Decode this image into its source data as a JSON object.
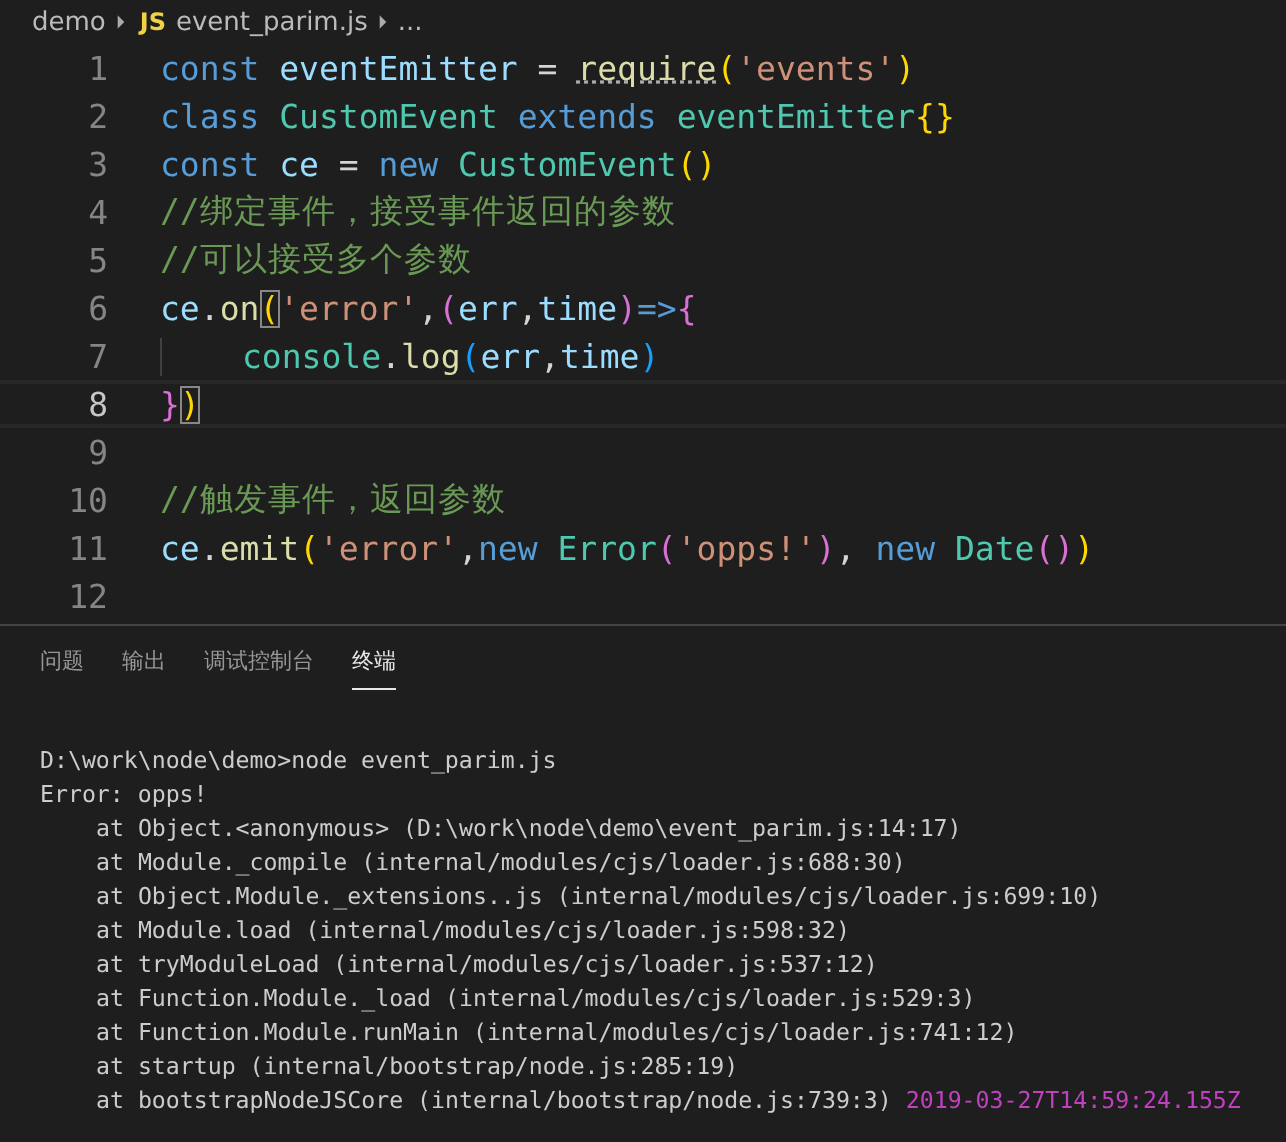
{
  "breadcrumb": {
    "folder": "demo",
    "file_badge": "JS",
    "file": "event_parim.js",
    "more": "..."
  },
  "editor": {
    "lines": [
      {
        "number": "1",
        "current": false,
        "indented": false,
        "tokens": [
          {
            "text": "const ",
            "kind": "keyword"
          },
          {
            "text": "eventEmitter",
            "kind": "var"
          },
          {
            "text": " = ",
            "kind": "plain"
          },
          {
            "text": "require",
            "kind": "func",
            "hinted": true
          },
          {
            "text": "(",
            "kind": "bracket1"
          },
          {
            "text": "'events'",
            "kind": "string"
          },
          {
            "text": ")",
            "kind": "bracket1"
          }
        ]
      },
      {
        "number": "2",
        "current": false,
        "indented": false,
        "tokens": [
          {
            "text": "class ",
            "kind": "keyword"
          },
          {
            "text": "CustomEvent ",
            "kind": "class"
          },
          {
            "text": "extends ",
            "kind": "keyword"
          },
          {
            "text": "eventEmitter",
            "kind": "class"
          },
          {
            "text": "{}",
            "kind": "bracket1"
          }
        ]
      },
      {
        "number": "3",
        "current": false,
        "indented": false,
        "tokens": [
          {
            "text": "const ",
            "kind": "keyword"
          },
          {
            "text": "ce",
            "kind": "var"
          },
          {
            "text": " = ",
            "kind": "plain"
          },
          {
            "text": "new ",
            "kind": "keyword"
          },
          {
            "text": "CustomEvent",
            "kind": "class"
          },
          {
            "text": "()",
            "kind": "bracket1"
          }
        ]
      },
      {
        "number": "4",
        "current": false,
        "indented": false,
        "tokens": [
          {
            "text": "//绑定事件，接受事件返回的参数",
            "kind": "comment"
          }
        ]
      },
      {
        "number": "5",
        "current": false,
        "indented": false,
        "tokens": [
          {
            "text": "//可以接受多个参数",
            "kind": "comment"
          }
        ]
      },
      {
        "number": "6",
        "current": false,
        "indented": false,
        "tokens": [
          {
            "text": "ce",
            "kind": "var"
          },
          {
            "text": ".",
            "kind": "plain"
          },
          {
            "text": "on",
            "kind": "func"
          },
          {
            "text": "(",
            "kind": "bracket1",
            "boxed": true
          },
          {
            "text": "'error'",
            "kind": "string"
          },
          {
            "text": ",",
            "kind": "plain"
          },
          {
            "text": "(",
            "kind": "bracket2"
          },
          {
            "text": "err",
            "kind": "var"
          },
          {
            "text": ",",
            "kind": "plain"
          },
          {
            "text": "time",
            "kind": "var"
          },
          {
            "text": ")",
            "kind": "bracket2"
          },
          {
            "text": "=>",
            "kind": "keyword"
          },
          {
            "text": "{",
            "kind": "bracket2"
          }
        ]
      },
      {
        "number": "7",
        "current": false,
        "indented": true,
        "tokens": [
          {
            "text": "console",
            "kind": "class"
          },
          {
            "text": ".",
            "kind": "plain"
          },
          {
            "text": "log",
            "kind": "func"
          },
          {
            "text": "(",
            "kind": "bracket3"
          },
          {
            "text": "err",
            "kind": "var"
          },
          {
            "text": ",",
            "kind": "plain"
          },
          {
            "text": "time",
            "kind": "var"
          },
          {
            "text": ")",
            "kind": "bracket3"
          }
        ]
      },
      {
        "number": "8",
        "current": true,
        "indented": false,
        "tokens": [
          {
            "text": "}",
            "kind": "bracket2"
          },
          {
            "text": ")",
            "kind": "bracket1",
            "boxed": true
          }
        ]
      },
      {
        "number": "9",
        "current": false,
        "indented": false
      },
      {
        "number": "10",
        "current": false,
        "indented": false,
        "tokens": [
          {
            "text": "//触发事件，返回参数",
            "kind": "comment"
          }
        ]
      },
      {
        "number": "11",
        "current": false,
        "indented": false,
        "tokens": [
          {
            "text": "ce",
            "kind": "var"
          },
          {
            "text": ".",
            "kind": "plain"
          },
          {
            "text": "emit",
            "kind": "func"
          },
          {
            "text": "(",
            "kind": "bracket1"
          },
          {
            "text": "'error'",
            "kind": "string"
          },
          {
            "text": ",",
            "kind": "plain"
          },
          {
            "text": "new ",
            "kind": "keyword"
          },
          {
            "text": "Error",
            "kind": "class"
          },
          {
            "text": "(",
            "kind": "bracket2"
          },
          {
            "text": "'opps!'",
            "kind": "string"
          },
          {
            "text": ")",
            "kind": "bracket2"
          },
          {
            "text": ", ",
            "kind": "plain"
          },
          {
            "text": "new ",
            "kind": "keyword"
          },
          {
            "text": "Date",
            "kind": "class"
          },
          {
            "text": "()",
            "kind": "bracket2"
          },
          {
            "text": ")",
            "kind": "bracket1"
          }
        ]
      },
      {
        "number": "12",
        "current": false,
        "indented": false
      }
    ]
  },
  "panel": {
    "tabs": [
      {
        "label": "问题",
        "selected": false
      },
      {
        "label": "输出",
        "selected": false
      },
      {
        "label": "调试控制台",
        "selected": false
      },
      {
        "label": "终端",
        "selected": true
      }
    ],
    "terminal": [
      {
        "kind": "command",
        "text": "D:\\work\\node\\demo>node event_parim.js"
      },
      {
        "kind": "error",
        "text": "Error: opps!"
      },
      {
        "kind": "stack",
        "text": "at Object.<anonymous> (D:\\work\\node\\demo\\event_parim.js:14:17)"
      },
      {
        "kind": "stack",
        "text": "at Module._compile (internal/modules/cjs/loader.js:688:30)"
      },
      {
        "kind": "stack",
        "text": "at Object.Module._extensions..js (internal/modules/cjs/loader.js:699:10)"
      },
      {
        "kind": "stack",
        "text": "at Module.load (internal/modules/cjs/loader.js:598:32)"
      },
      {
        "kind": "stack",
        "text": "at tryModuleLoad (internal/modules/cjs/loader.js:537:12)"
      },
      {
        "kind": "stack",
        "text": "at Function.Module._load (internal/modules/cjs/loader.js:529:3)"
      },
      {
        "kind": "stack",
        "text": "at Function.Module.runMain (internal/modules/cjs/loader.js:741:12)"
      },
      {
        "kind": "stack",
        "text": "at startup (internal/bootstrap/node.js:285:19)"
      },
      {
        "kind": "stack",
        "text": "at bootstrapNodeJSCore (internal/bootstrap/node.js:739:3)",
        "timestamp": "2019-03-27T14:59:24.155Z"
      }
    ]
  }
}
